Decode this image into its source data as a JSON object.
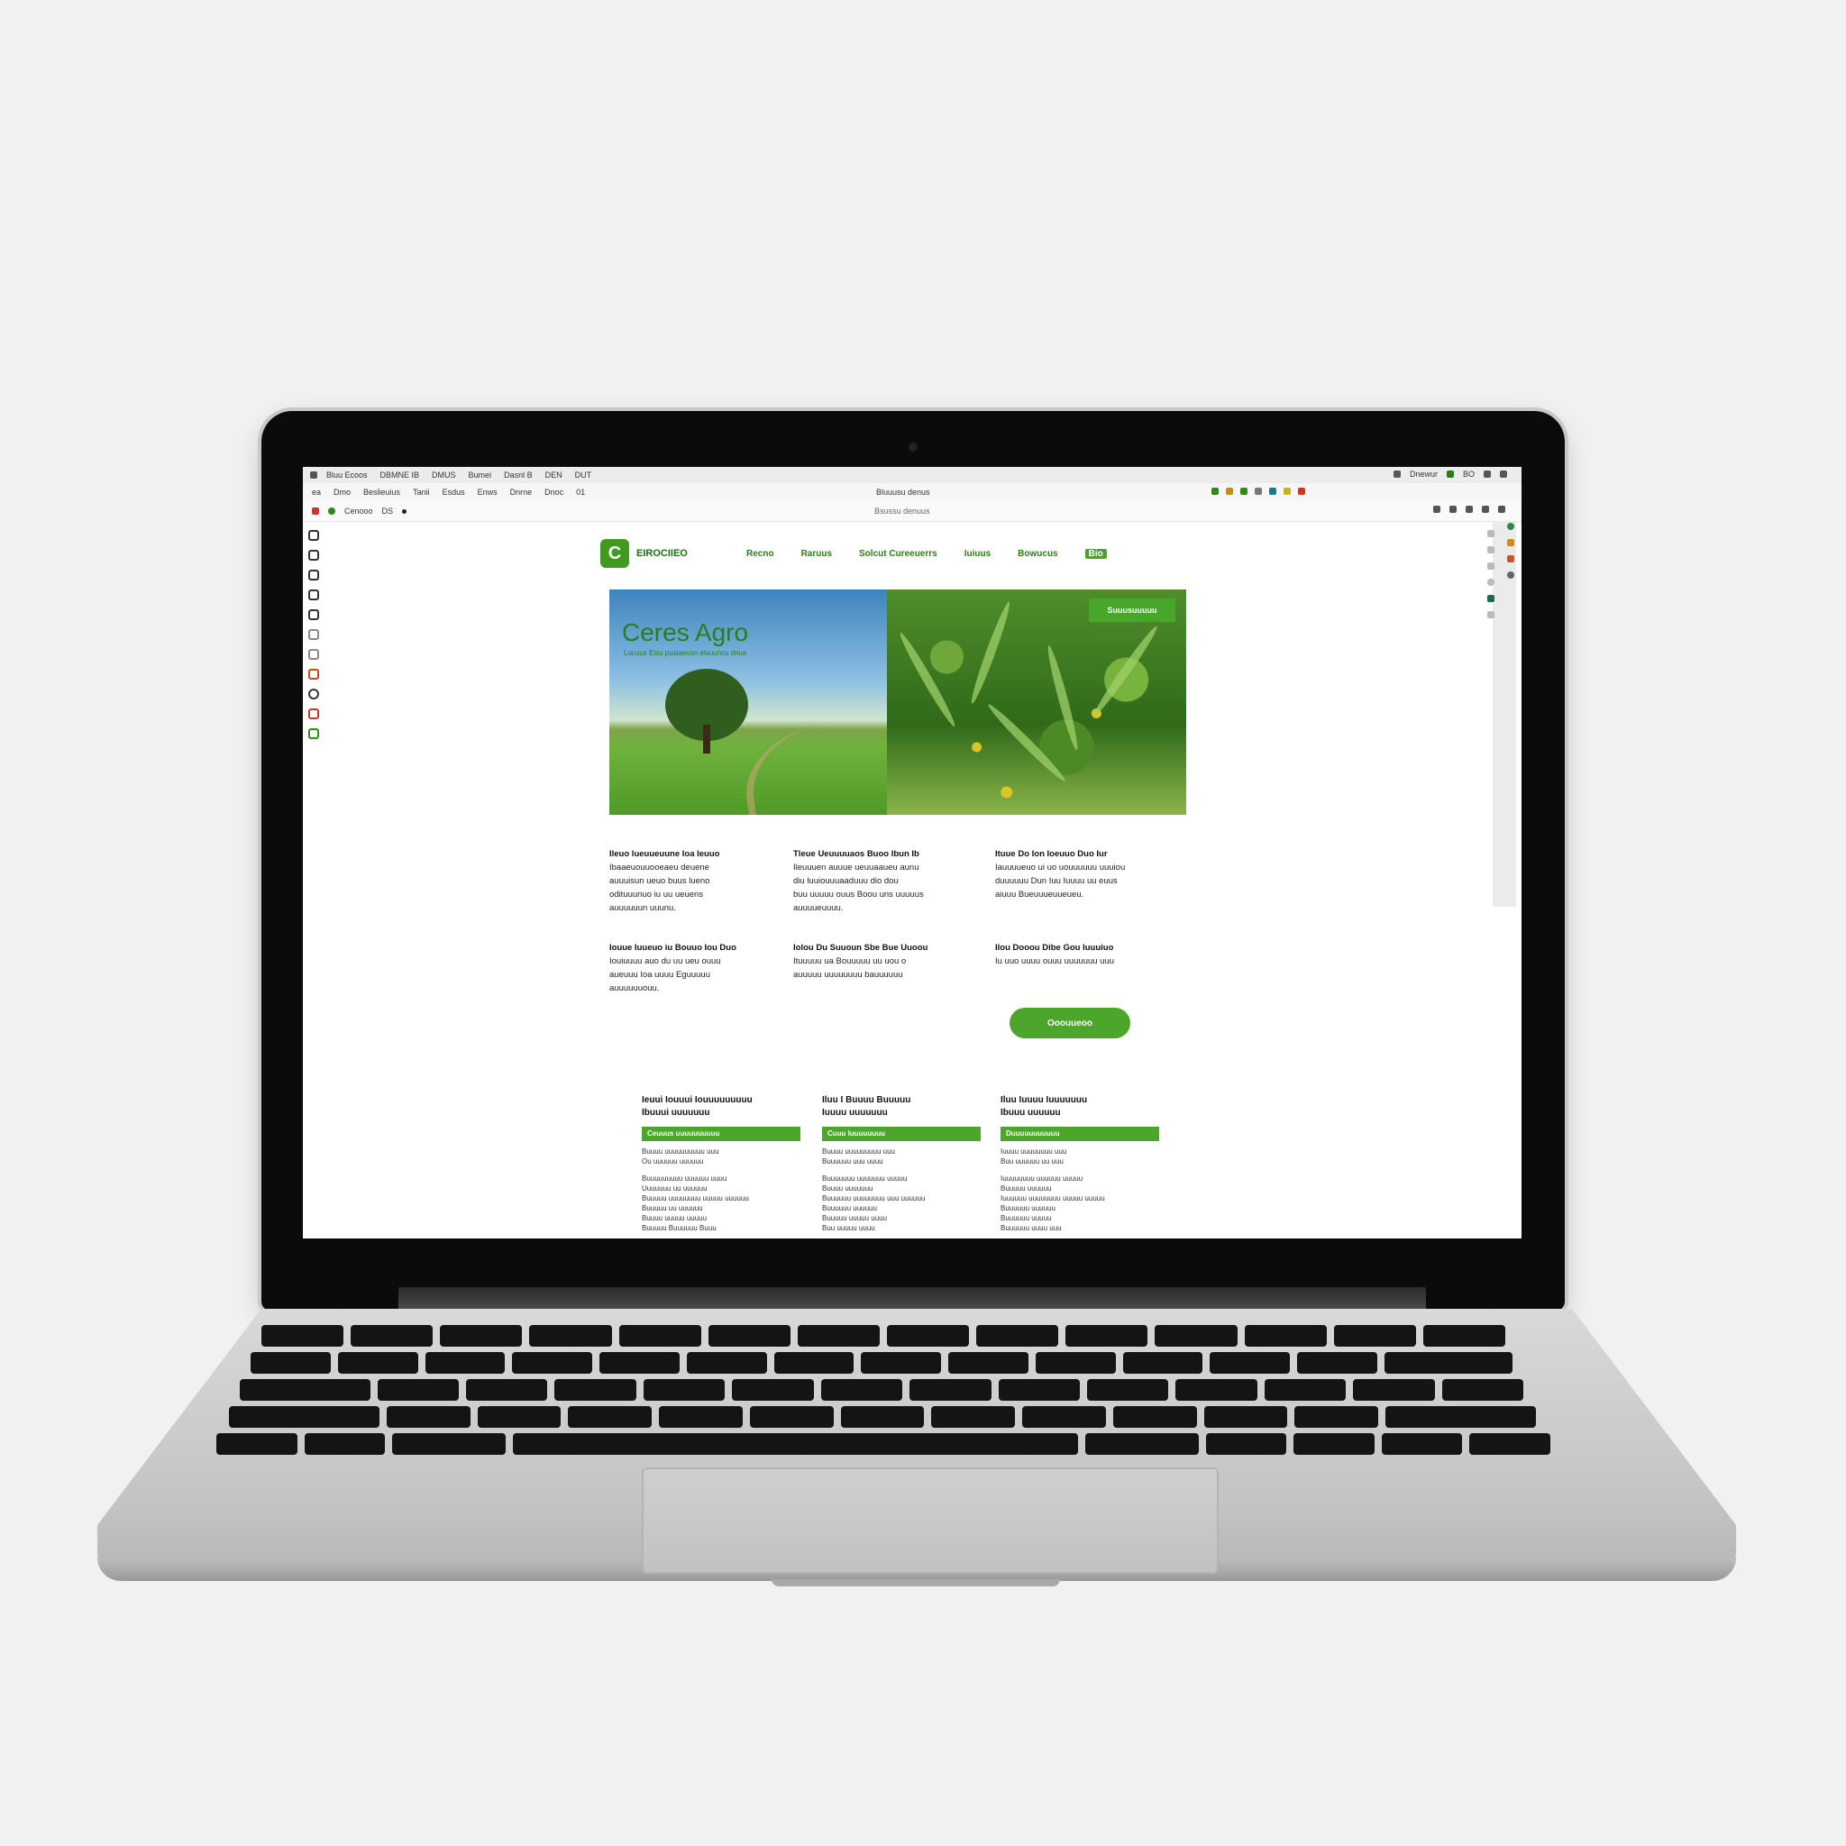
{
  "browser": {
    "menubar_items": [
      "Bluu Ecoos",
      "DBMNE IB",
      "DMUS",
      "Bumei",
      "Dasnl B",
      "DEN",
      "DUT"
    ],
    "menubar_right": [
      "Dnewur",
      "BO"
    ],
    "tabs": [
      "ea",
      "Dmo",
      "Beslieuius",
      "Tanii",
      "Esdus",
      "Enws",
      "Dnrne",
      "Dnoc",
      "01"
    ],
    "tab_center": "Bluuusu denus",
    "address_left": "Cenooo",
    "address_left2": "DS",
    "url": "Bsussu denuus"
  },
  "site": {
    "logo_letter": "C",
    "logo_text": "EIROCIIEO",
    "nav": [
      "Recno",
      "Raruus",
      "Solcut Cureeuerrs",
      "Iuiuus",
      "Bowucus",
      "Bio"
    ],
    "hero": {
      "title": "Ceres Agro",
      "subtitle": "Lucuus Elsu pusiaeusn elsuuncu dnue",
      "button": "Suuusuuuuu"
    },
    "features": [
      {
        "title": "Ileuo lueuueuune Ioa Ieuuo",
        "lines": [
          "Ibaaeuouuooeaeu deuene",
          "auuuisun ueuo buus lueno",
          "odituuunuo iu uu ueuens",
          "auuuuuun uuunu."
        ]
      },
      {
        "title": "Tleue Ueuuuuaos Buoo Ibun Ib",
        "lines": [
          "Ileuuuen auuue ueuuaaueu aunu",
          "diu luuiouuuaaduuu dio dou",
          "buu uuuuu ouus Boou uns uuuuus",
          "auuuueuuuu."
        ]
      },
      {
        "title": "Ituue Do Ion Ioeuuo Duo Iur",
        "lines": [
          "Iauuuueuo ui uo uouuuuuu uuuiou",
          "duuuuuu Dun Iuu Iuuuu uu euus",
          "aiuuu Bueuuueuueueu."
        ]
      },
      {
        "title": "Iouue Iuueuo iu Bouuo Iou Duo",
        "lines": [
          "Iouiuuuu auo du uu ueu ouuu",
          "aueuuu Ioa uuuu Eguuuuu",
          "auuuuuuouu."
        ]
      },
      {
        "title": "Iolou Du Suuoun Sbe Bue Uuoou",
        "lines": [
          "Ituuuuu ua Bouuuuu uu uou o",
          "auuuuu uuuuuuuu bauuuuuu"
        ]
      },
      {
        "title": "Ilou Dooou Dibe Gou Iuuuiuo",
        "lines": [
          "Iu uuo uuuu ouuu uuuuuuu uuu"
        ]
      }
    ],
    "cta": "Ooouueoo",
    "cards": [
      {
        "title": "Ieuui Iouuui Iouuuuuuuuu",
        "title2": "Ibuuui uuuuuuu",
        "bar": "Ceuuus uuuuuuuuuu",
        "lines": [
          "Buuuu uuuuuuuuuu uuu",
          "Ou uuuuuu uuuuuu",
          "",
          "Buuuuuuuuu uuuuuu uuuu",
          "Uuuuuuu uu uuuuuu",
          "Buuuuu uuuuuuuu uuuuu uuuuuu",
          "Buuuuu uu uuuuuu",
          "Buuuu uuuuu uuuuu",
          "Buuuuu Buuuuuu Buuu"
        ]
      },
      {
        "title": "Iluu I Buuuu Buuuuu",
        "title2": "Iuuuu uuuuuuu",
        "bar": "Cuuu Iuuuuuuuu",
        "lines": [
          "Buuuu uuuuuuuuu uuu",
          "Buuuuuu uuu uuuu",
          "",
          "Buuuuuuu uuuuuuu uuuuu",
          "Buuuu uuuuuuu",
          "Buuuuuu uuuuuuuu uuu uuuuuu",
          "Buuuuuu uuuuuu",
          "Buuuuu uuuuu uuuu",
          "Buu uuuuu uuuu"
        ]
      },
      {
        "title": "Iluu Iuuuu Iuuuuuuu",
        "title2": "Ibuuu uuuuuu",
        "bar": "Duuuuuuuuuuu",
        "lines": [
          "Iuuuu uuuuuuuu uuu",
          "Buu uuuuuu uu uuu",
          "",
          "Iuuuuuuuu uuuuuu uuuuu",
          "Buuuuu uuuuuu",
          "Iuuuuuu uuuuuuuu uuuuu uuuuu",
          "Buuuuuu uuuuuu",
          "Buuuuuu uuuuu",
          "Buuuuuu uuuu uuu"
        ]
      }
    ]
  },
  "colors": {
    "brand_green": "#3f9a1f",
    "accent_green": "#4ba62b"
  }
}
